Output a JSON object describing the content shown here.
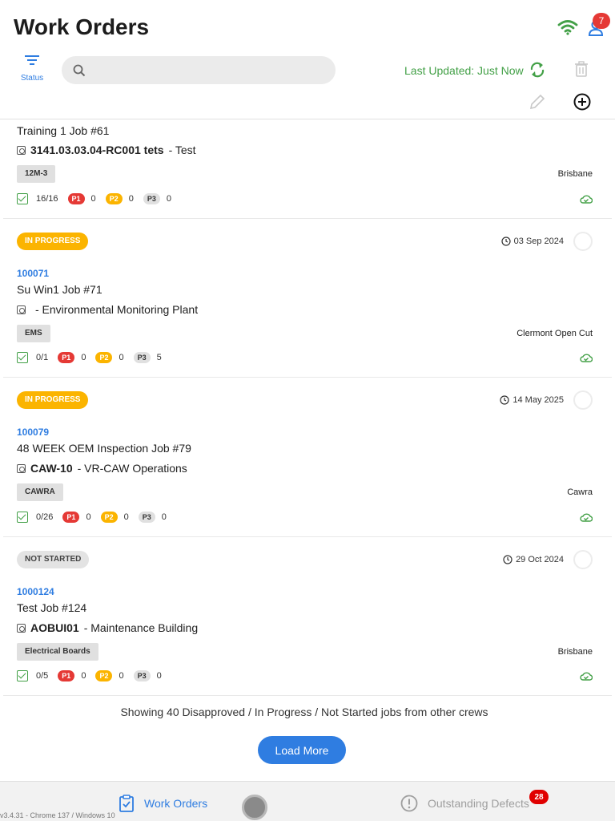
{
  "header": {
    "title": "Work Orders",
    "notification_count": "7",
    "filter_label": "Status",
    "search_placeholder": "",
    "last_updated": "Last Updated: Just Now"
  },
  "colors": {
    "accent_blue": "#2f7de1",
    "online_green": "#43a047",
    "in_progress": "#fbb400",
    "p1_red": "#e53935"
  },
  "orders": [
    {
      "status": "",
      "date": "",
      "wo_number": "",
      "job": "Training 1 Job #61",
      "asset_code": "3141.03.03.04-RC001 tets",
      "asset_desc": "- Test",
      "tag": "12M-3",
      "site": "Brisbane",
      "progress": "16/16",
      "p1": "0",
      "p2": "0",
      "p3": "0"
    },
    {
      "status": "IN PROGRESS",
      "date": "03 Sep 2024",
      "wo_number": "100071",
      "job": "Su Win1 Job #71",
      "asset_code": "",
      "asset_desc": "- Environmental Monitoring Plant",
      "tag": "EMS",
      "site": "Clermont Open Cut",
      "progress": "0/1",
      "p1": "0",
      "p2": "0",
      "p3": "5"
    },
    {
      "status": "IN PROGRESS",
      "date": "14 May 2025",
      "wo_number": "100079",
      "job": "48 WEEK OEM Inspection Job #79",
      "asset_code": "CAW-10",
      "asset_desc": "- VR-CAW Operations",
      "tag": "CAWRA",
      "site": "Cawra",
      "progress": "0/26",
      "p1": "0",
      "p2": "0",
      "p3": "0"
    },
    {
      "status": "NOT STARTED",
      "date": "29 Oct 2024",
      "wo_number": "1000124",
      "job": "Test Job #124",
      "asset_code": "AOBUI01",
      "asset_desc": "- Maintenance Building",
      "tag": "Electrical Boards",
      "site": "Brisbane",
      "progress": "0/5",
      "p1": "0",
      "p2": "0",
      "p3": "0"
    }
  ],
  "priority_labels": {
    "p1": "P1",
    "p2": "P2",
    "p3": "P3"
  },
  "footer": {
    "showing_text": "Showing 40 Disapproved / In Progress / Not Started jobs from other crews",
    "load_more": "Load More"
  },
  "bottom_nav": {
    "work_orders": "Work Orders",
    "outstanding_defects": "Outstanding Defects",
    "defects_count": "28",
    "version": "v3.4.31 - Chrome 137 / Windows 10"
  }
}
